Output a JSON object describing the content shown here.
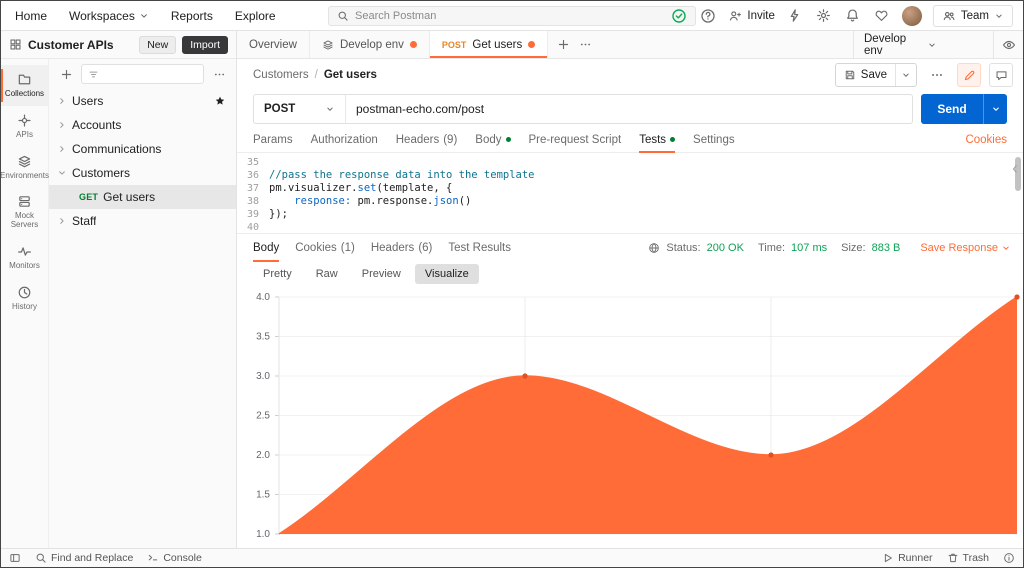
{
  "header": {
    "nav": [
      {
        "label": "Home"
      },
      {
        "label": "Workspaces",
        "caret": true
      },
      {
        "label": "Reports"
      },
      {
        "label": "Explore"
      }
    ],
    "search_placeholder": "Search Postman",
    "invite_label": "Invite",
    "team_label": "Team"
  },
  "rail": {
    "items": [
      {
        "label": "Collections",
        "icon": "collections-icon",
        "active": true
      },
      {
        "label": "APIs",
        "icon": "apis-icon"
      },
      {
        "label": "Environments",
        "icon": "environments-icon"
      },
      {
        "label": "Mock Servers",
        "icon": "mock-servers-icon"
      },
      {
        "label": "Monitors",
        "icon": "monitors-icon"
      },
      {
        "label": "History",
        "icon": "history-icon"
      }
    ]
  },
  "sidebar": {
    "workspace_title": "Customer APIs",
    "new_button": "New",
    "import_button": "Import",
    "tree": [
      {
        "label": "Users",
        "level": 0,
        "expanded": false,
        "starred": true
      },
      {
        "label": "Accounts",
        "level": 0,
        "expanded": false
      },
      {
        "label": "Communications",
        "level": 0,
        "expanded": false
      },
      {
        "label": "Customers",
        "level": 0,
        "expanded": true
      },
      {
        "label": "Get users",
        "level": 1,
        "method": "GET",
        "selected": true
      },
      {
        "label": "Staff",
        "level": 0,
        "expanded": false
      }
    ]
  },
  "tabbar": {
    "tabs": [
      {
        "label": "Overview",
        "type": "overview"
      },
      {
        "label": "Develop env",
        "type": "env",
        "dot": true
      },
      {
        "label": "Get users",
        "type": "request",
        "method": "POST",
        "dot": true,
        "active": true
      }
    ],
    "env_selector": "Develop env"
  },
  "request": {
    "breadcrumb": [
      "Customers",
      "Get users"
    ],
    "save_label": "Save",
    "method": "POST",
    "url": "postman-echo.com/post",
    "send_label": "Send",
    "tabs": [
      {
        "label": "Params"
      },
      {
        "label": "Authorization"
      },
      {
        "label": "Headers",
        "count": "(9)"
      },
      {
        "label": "Body",
        "dot": true
      },
      {
        "label": "Pre-request Script"
      },
      {
        "label": "Tests",
        "dot": true,
        "active": true
      },
      {
        "label": "Settings"
      }
    ],
    "cookies_link": "Cookies"
  },
  "editor": {
    "lines": [
      {
        "num": "35",
        "segments": []
      },
      {
        "num": "36",
        "segments": [
          {
            "t": "//pass the response data into the template",
            "c": "comment"
          }
        ]
      },
      {
        "num": "37",
        "segments": [
          {
            "t": "pm.visualizer.",
            "c": "ident"
          },
          {
            "t": "set",
            "c": "fn"
          },
          {
            "t": "(template, {",
            "c": "ident"
          }
        ]
      },
      {
        "num": "38",
        "segments": [
          {
            "t": "    ",
            "c": "ident"
          },
          {
            "t": "response:",
            "c": "prop"
          },
          {
            "t": " pm.response.",
            "c": "ident"
          },
          {
            "t": "json",
            "c": "fn"
          },
          {
            "t": "()",
            "c": "ident"
          }
        ]
      },
      {
        "num": "39",
        "segments": [
          {
            "t": "});",
            "c": "ident"
          }
        ]
      },
      {
        "num": "40",
        "segments": []
      }
    ]
  },
  "response": {
    "tabs": [
      {
        "label": "Body",
        "active": true
      },
      {
        "label": "Cookies",
        "count": "(1)"
      },
      {
        "label": "Headers",
        "count": "(6)"
      },
      {
        "label": "Test Results"
      }
    ],
    "meta": {
      "status_label": "Status:",
      "status_value": "200 OK",
      "time_label": "Time:",
      "time_value": "107 ms",
      "size_label": "Size:",
      "size_value": "883 B",
      "save_label": "Save Response"
    },
    "view_tabs": [
      {
        "label": "Pretty"
      },
      {
        "label": "Raw"
      },
      {
        "label": "Preview"
      },
      {
        "label": "Visualize",
        "active": true
      }
    ]
  },
  "chart_data": {
    "type": "area",
    "x": [
      1,
      2,
      3,
      4
    ],
    "values": [
      1,
      3,
      2,
      4
    ],
    "ylim": [
      1,
      4
    ],
    "yticks": [
      4.0,
      3.5,
      3.0,
      2.5,
      2.0,
      1.5,
      1.0
    ],
    "area_color": "#FF6C37",
    "point_color": "#E05025",
    "grid": true,
    "legend": false,
    "title": "",
    "xlabel": "",
    "ylabel": ""
  },
  "statusbar": {
    "left": [
      {
        "icon": "sidebar-toggle-icon",
        "label": ""
      },
      {
        "icon": "search-icon",
        "label": "Find and Replace"
      },
      {
        "icon": "console-icon",
        "label": "Console"
      }
    ],
    "right": [
      {
        "icon": "runner-icon",
        "label": "Runner"
      },
      {
        "icon": "trash-icon",
        "label": "Trash"
      },
      {
        "icon": "info-icon",
        "label": ""
      }
    ]
  },
  "colors": {
    "accent": "#FF6C37",
    "send_button": "#0265D2",
    "method_get": "#007F31",
    "status_green": "#0CA454"
  }
}
